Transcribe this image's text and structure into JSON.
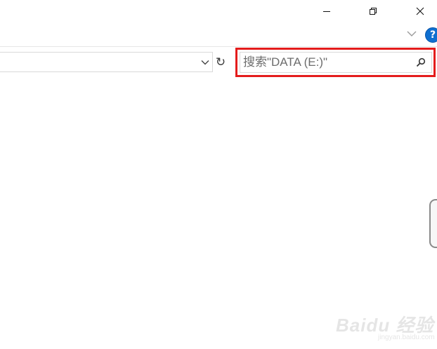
{
  "window_controls": {
    "minimize": "─",
    "restore": "❐",
    "close": "✕"
  },
  "ribbon": {
    "expand_icon": "chevron-down-icon",
    "help_label": "?"
  },
  "address_bar": {
    "value": "",
    "dropdown_icon": "chevron-down-icon",
    "refresh_glyph": "↻"
  },
  "search": {
    "placeholder": "搜索\"DATA (E:)\"",
    "icon": "search-icon",
    "highlight_color": "#e41c1c"
  },
  "watermark": {
    "brand": "Baidu 经验",
    "sub": "jingyan.baidu.com"
  },
  "colors": {
    "help_blue": "#0f6fd0",
    "border_gray": "#d9d9d9"
  }
}
